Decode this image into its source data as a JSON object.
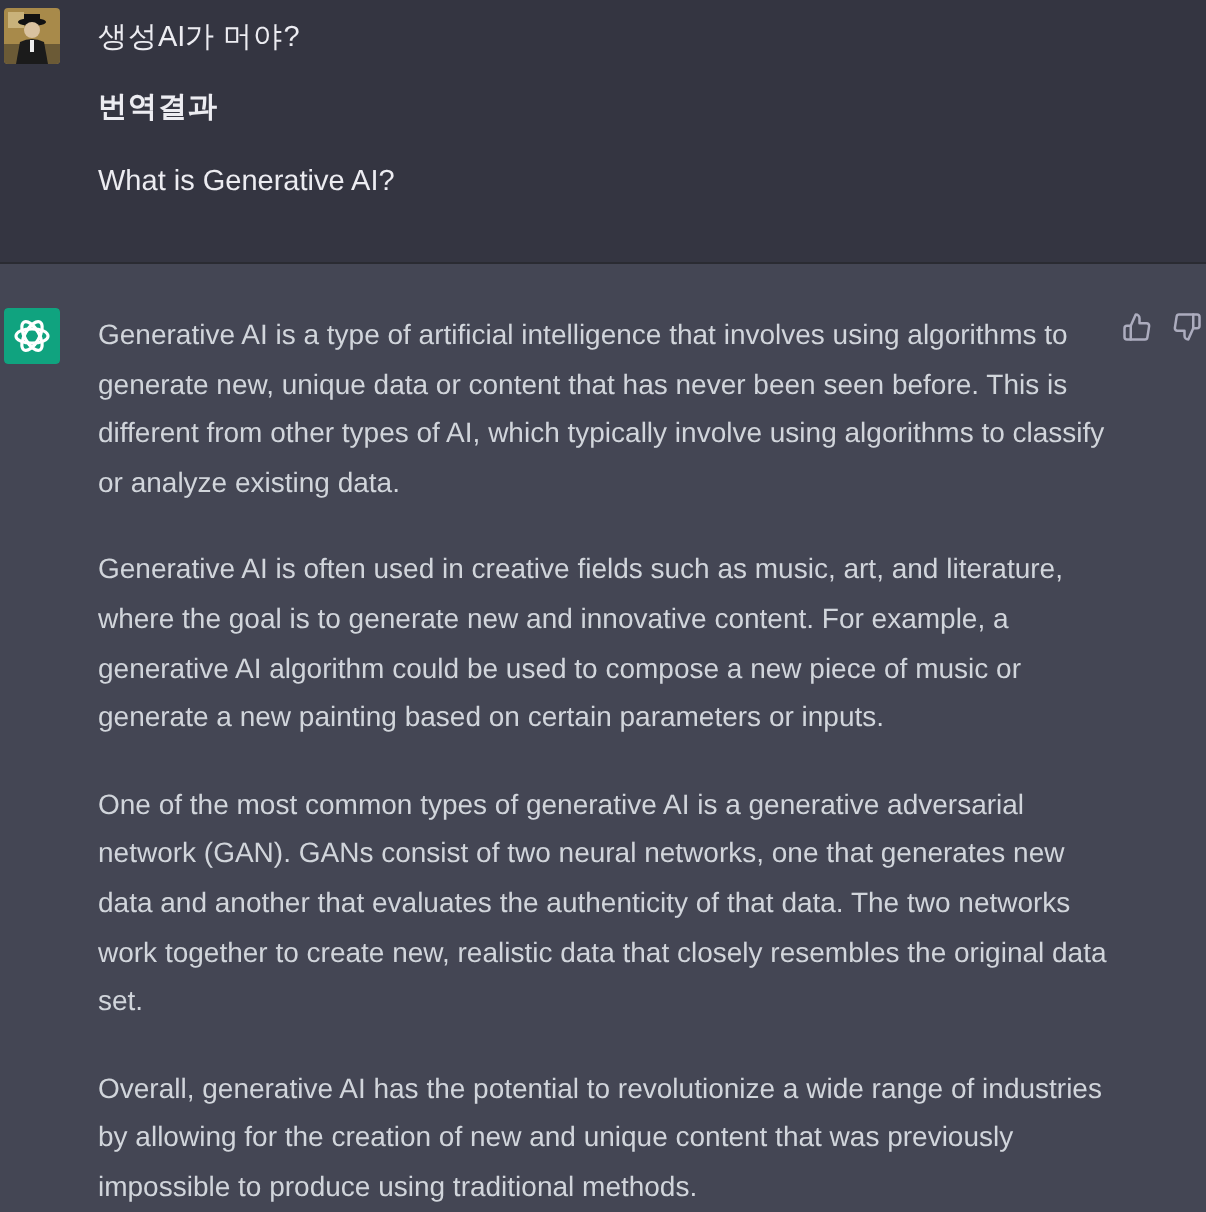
{
  "user_message": {
    "text": "생성AI가 머야?",
    "translation_label": "번역결과",
    "translation": "What is Generative AI?"
  },
  "assistant_message": {
    "paragraphs": [
      "Generative AI is a type of artificial intelligence that involves using algorithms to generate new, unique data or content that has never been seen before. This is different from other types of AI, which typically involve using algorithms to classify or analyze existing data.",
      "Generative AI is often used in creative fields such as music, art, and literature, where the goal is to generate new and innovative content. For example, a generative AI algorithm could be used to compose a new piece of music or generate a new painting based on certain parameters or inputs.",
      "One of the most common types of generative AI is a generative adversarial network (GAN). GANs consist of two neural networks, one that generates new data and another that evaluates the authenticity of that data. The two networks work together to create new, realistic data that closely resembles the original data set.",
      "Overall, generative AI has the potential to revolutionize a wide range of industries by allowing for the creation of new and unique content that was previously impossible to produce using traditional methods."
    ]
  }
}
